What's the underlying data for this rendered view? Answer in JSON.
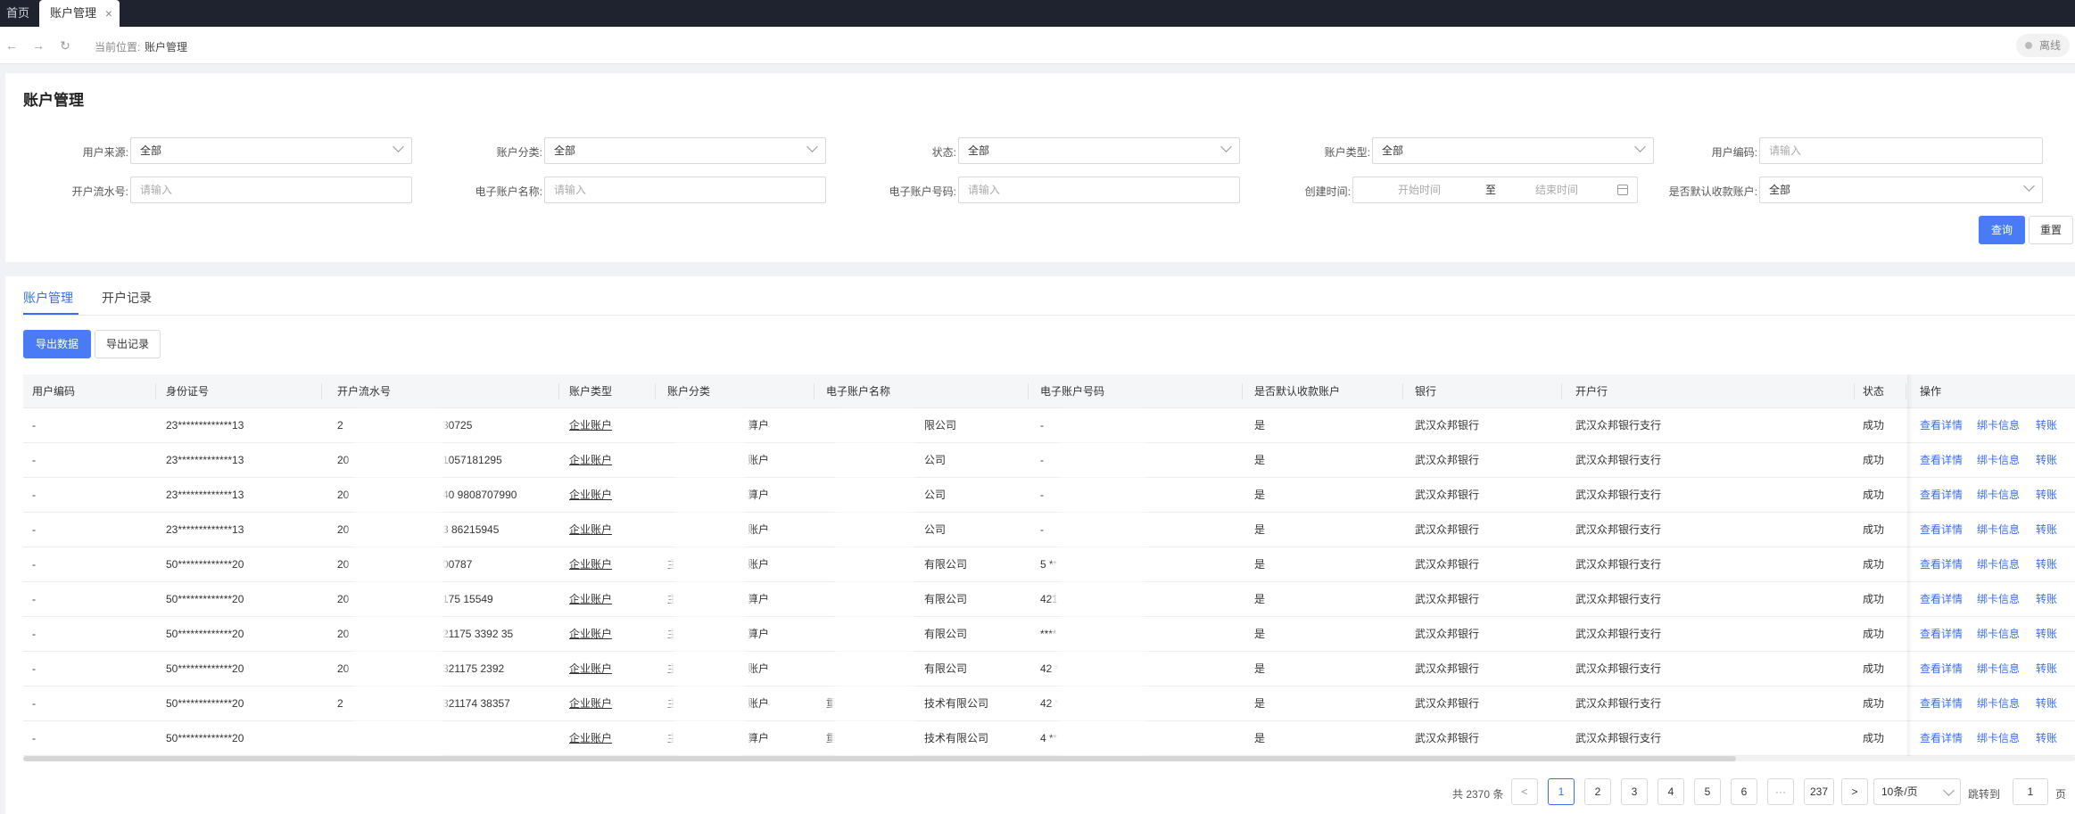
{
  "tabs": {
    "home": "首页",
    "active": "账户管理",
    "close": "×"
  },
  "nav": {
    "back": "←",
    "forward": "→",
    "refresh": "↻",
    "crumb_prefix": "当前位置:",
    "crumb_current": "账户管理",
    "status": "离线"
  },
  "filter": {
    "title": "账户管理",
    "user_source": {
      "label": "用户来源:",
      "value": "全部"
    },
    "account_category": {
      "label": "账户分类:",
      "value": "全部"
    },
    "status": {
      "label": "状态:",
      "value": "全部"
    },
    "account_type": {
      "label": "账户类型:",
      "value": "全部"
    },
    "user_code": {
      "label": "用户编码:",
      "placeholder": "请输入"
    },
    "open_serial": {
      "label": "开户流水号:",
      "placeholder": "请输入"
    },
    "e_account_name": {
      "label": "电子账户名称:",
      "placeholder": "请输入"
    },
    "e_account_no": {
      "label": "电子账户号码:",
      "placeholder": "请输入"
    },
    "created_time": {
      "label": "创建时间:",
      "start": "开始时间",
      "sep": "至",
      "end": "结束时间"
    },
    "default_receiving": {
      "label": "是否默认收款账户:",
      "value": "全部"
    },
    "query_button": "查询",
    "reset_button": "重置"
  },
  "list": {
    "tabs": [
      "账户管理",
      "开户记录"
    ],
    "export_data_button": "导出数据",
    "export_record_button": "导出记录",
    "columns": [
      "用户编码",
      "身份证号",
      "开户流水号",
      "账户类型",
      "账户分类",
      "电子账户名称",
      "电子账户号码",
      "是否默认收款账户",
      "银行",
      "开户行",
      "状态",
      "操作"
    ],
    "rows": [
      {
        "user_code": "-",
        "id_no": "23*************13",
        "serial": "2",
        "serial_tail": "30725",
        "acct_type": "企业账户",
        "category": "",
        "category_tail": "算户",
        "e_name": "",
        "e_name_tail": "限公司",
        "e_no": "-",
        "default": "是",
        "bank": "武汉众邦银行",
        "branch": "武汉众邦银行支行",
        "status": "成功"
      },
      {
        "user_code": "-",
        "id_no": "23*************13",
        "serial": "20",
        "serial_tail": "1057181295",
        "acct_type": "企业账户",
        "category": "",
        "category_tail": "账户",
        "e_name": "",
        "e_name_tail": "公司",
        "e_no": "-",
        "default": "是",
        "bank": "武汉众邦银行",
        "branch": "武汉众邦银行支行",
        "status": "成功"
      },
      {
        "user_code": "-",
        "id_no": "23*************13",
        "serial": "20",
        "serial_tail": "40    9808707990",
        "acct_type": "企业账户",
        "category": "",
        "category_tail": "算户",
        "e_name": "",
        "e_name_tail": "公司",
        "e_no": "-",
        "default": "是",
        "bank": "武汉众邦银行",
        "branch": "武汉众邦银行支行",
        "status": "成功"
      },
      {
        "user_code": "-",
        "id_no": "23*************13",
        "serial": "20",
        "serial_tail": "3     86215945",
        "acct_type": "企业账户",
        "category": "",
        "category_tail": "账户",
        "e_name": "",
        "e_name_tail": "公司",
        "e_no": "-",
        "default": "是",
        "bank": "武汉众邦银行",
        "branch": "武汉众邦银行支行",
        "status": "成功"
      },
      {
        "user_code": "-",
        "id_no": "50*************20",
        "serial": "20",
        "serial_tail": "00787",
        "acct_type": "企业账户",
        "category": "主",
        "category_tail": "账户",
        "e_name": "",
        "e_name_tail": "有限公司",
        "e_no": "5 **** **** **** ** 9",
        "default": "是",
        "bank": "武汉众邦银行",
        "branch": "武汉众邦银行支行",
        "status": "成功"
      },
      {
        "user_code": "-",
        "id_no": "50*************20",
        "serial": "20",
        "serial_tail": "175      15549",
        "acct_type": "企业账户",
        "category": "主",
        "category_tail": "算户",
        "e_name": "",
        "e_name_tail": "有限公司",
        "e_no": "421 **** **** **** ** 9E",
        "default": "是",
        "bank": "武汉众邦银行",
        "branch": "武汉众邦银行支行",
        "status": "成功"
      },
      {
        "user_code": "-",
        "id_no": "50*************20",
        "serial": "20",
        "serial_tail": "21175    3392   35",
        "acct_type": "企业账户",
        "category": "主",
        "category_tail": "算户",
        "e_name": "",
        "e_name_tail": "有限公司",
        "e_no": "**** **** **** ** 3B",
        "default": "是",
        "bank": "武汉众邦银行",
        "branch": "武汉众邦银行支行",
        "status": "成功"
      },
      {
        "user_code": "-",
        "id_no": "50*************20",
        "serial": "20",
        "serial_tail": "321175     2392",
        "acct_type": "企业账户",
        "category": "主",
        "category_tail": "账户",
        "e_name": "",
        "e_name_tail": "有限公司",
        "e_no": "42 **** **** **** ** 3B",
        "default": "是",
        "bank": "武汉众邦银行",
        "branch": "武汉众邦银行支行",
        "status": "成功"
      },
      {
        "user_code": "-",
        "id_no": "50*************20",
        "serial": "2",
        "serial_tail": "321174    38357",
        "acct_type": "企业账户",
        "category": "主",
        "category_tail": "账户",
        "e_name": "重",
        "e_name_tail": "技术有限公司",
        "e_no": "42 **** **** **** ** 7B",
        "default": "是",
        "bank": "武汉众邦银行",
        "branch": "武汉众邦银行支行",
        "status": "成功"
      },
      {
        "user_code": "-",
        "id_no": "50*************20",
        "serial": "",
        "serial_tail": "",
        "acct_type": "企业账户",
        "category": "主",
        "category_tail": "算户",
        "e_name": "重庆",
        "e_name_tail": "技术有限公司",
        "e_no": "4 **** **** **** ** 7B",
        "default": "是",
        "bank": "武汉众邦银行",
        "branch": "武汉众邦银行支行",
        "status": "成功"
      }
    ],
    "ops": [
      "查看详情",
      "绑卡信息",
      "转账"
    ]
  },
  "pagination": {
    "total": "共 2370 条",
    "prev": "<",
    "pages": [
      "1",
      "2",
      "3",
      "4",
      "5",
      "6",
      "···",
      "237"
    ],
    "next": ">",
    "page_size": "10条/页",
    "jump_label": "跳转到",
    "jump_value": "1",
    "jump_suffix": "页"
  },
  "colors": {
    "primary": "#4a7bf7",
    "link": "#3a6df0",
    "topbar": "#1f2330"
  }
}
